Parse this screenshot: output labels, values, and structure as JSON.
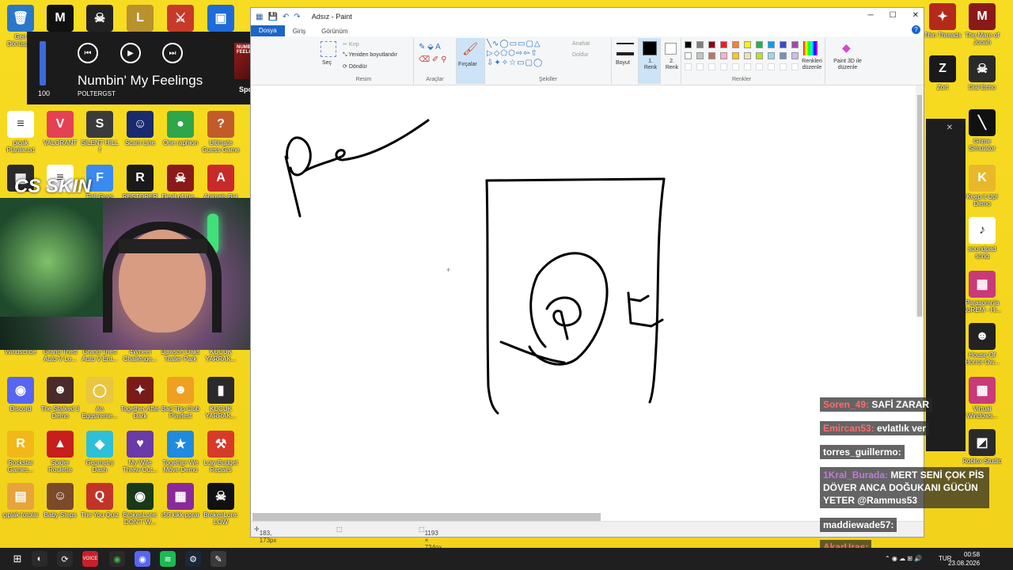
{
  "desktop_left": [
    {
      "label": "Geri Dönüşüm",
      "color": "#2b78c9",
      "glyph": "🗑"
    },
    {
      "label": "",
      "color": "#111",
      "glyph": "M"
    },
    {
      "label": "",
      "color": "#222",
      "glyph": "☠"
    },
    {
      "label": "",
      "color": "#b9922d",
      "glyph": "L"
    },
    {
      "label": "",
      "color": "#c73a2a",
      "glyph": "⚔"
    },
    {
      "label": "",
      "color": "#1e6bd9",
      "glyph": "▣"
    }
  ],
  "desktop_row2": [
    {
      "label": "picak Planlar.txt",
      "color": "#ffffff",
      "glyph": "≡"
    },
    {
      "label": "VALORANT",
      "color": "#e54154",
      "glyph": "V"
    },
    {
      "label": "SILENT HILL f",
      "color": "#3b3b3b",
      "glyph": "S"
    },
    {
      "label": "Scam Line",
      "color": "#1a2a6e",
      "glyph": "☺"
    },
    {
      "label": "One raphion",
      "color": "#2fa64a",
      "glyph": "●"
    },
    {
      "label": "Ultimate Guess Game",
      "color": "#c25b2a",
      "glyph": "?"
    }
  ],
  "desktop_row3": [
    {
      "label": "Discord",
      "color": "#5865f2",
      "glyph": "◉"
    },
    {
      "label": "The Stalked 3 Demo",
      "color": "#4a2a2a",
      "glyph": "☻"
    },
    {
      "label": "An Eggstreme...",
      "color": "#e8c640",
      "glyph": "◯"
    },
    {
      "label": "Together After Dark",
      "color": "#7a1a1a",
      "glyph": "✦"
    },
    {
      "label": "Bad Trip Club Playtest",
      "color": "#f0a020",
      "glyph": "☻"
    },
    {
      "label": "KUÇUK YARRAK...",
      "color": "#2a2a2a",
      "glyph": "▮"
    }
  ],
  "desktop_row4": [
    {
      "label": "Rockstar Games...",
      "color": "#f2b81a",
      "glyph": "R"
    },
    {
      "label": "Spider Roulette",
      "color": "#c81e1e",
      "glyph": "▲"
    },
    {
      "label": "Geometry Dash",
      "color": "#2ec0d8",
      "glyph": "◆"
    },
    {
      "label": "My Wife Threw Out...",
      "color": "#6a3aa8",
      "glyph": "♥"
    },
    {
      "label": "Together We Move Demo",
      "color": "#1f8ae0",
      "glyph": "★"
    },
    {
      "label": "Low-Budget Repairs",
      "color": "#d83a2a",
      "glyph": "⚒"
    }
  ],
  "desktop_row5": [
    {
      "label": "çıplak fotolar",
      "color": "#e6a43a",
      "glyph": "▤"
    },
    {
      "label": "Baby Steps",
      "color": "#7a4a2a",
      "glyph": "☺"
    },
    {
      "label": "The You Quiz",
      "color": "#c2342a",
      "glyph": "Q"
    },
    {
      "label": "BrokenLore: DON'T W...",
      "color": "#183a1a",
      "glyph": "◉"
    },
    {
      "label": "r55 kikk pprar",
      "color": "#8a2a9a",
      "glyph": "▦"
    },
    {
      "label": "BrokenLore: LOW",
      "color": "#111",
      "glyph": "☠"
    }
  ],
  "desktop_mid_labels": [
    "Windscribe",
    "Grand Theft Auto V Le...",
    "Grand Theft Auto V Ent...",
    "4Wheel Challenge...",
    "Dawson Oaks Trailer Park",
    "KUÇUK YARRAK..."
  ],
  "desktop_row_games": [
    {
      "label": "",
      "color": "#2a2a2a",
      "glyph": "▦"
    },
    {
      "label": "",
      "color": "#fff",
      "glyph": "≡"
    },
    {
      "label": "Fall Guys",
      "color": "#3a8af0",
      "glyph": "F"
    },
    {
      "label": "RESTORER",
      "color": "#1a1a1a",
      "glyph": "R"
    },
    {
      "label": "Devil of the...",
      "color": "#8a1a1a",
      "glyph": "☠"
    },
    {
      "label": "Animals Bar",
      "color": "#c82a2a",
      "glyph": "A"
    }
  ],
  "desktop_right": [
    {
      "label": "Thin Threads",
      "color": "#b42a1a",
      "glyph": "✦"
    },
    {
      "label": "The Mare of Jonah",
      "color": "#8a1a1a",
      "glyph": "M"
    },
    {
      "label": "Zort",
      "color": "#1a1a1a",
      "glyph": "Z"
    },
    {
      "label": "Dial Echo",
      "color": "#2a2a2a",
      "glyph": "☠"
    },
    {
      "label": "Grime Simulator",
      "color": "#111",
      "glyph": "╲"
    },
    {
      "label": "Keep it Up! Demo",
      "color": "#e8b82a",
      "glyph": "K"
    },
    {
      "label": "soundpad song",
      "color": "#ffffff",
      "glyph": "♪"
    },
    {
      "label": "Parasomnia NoREM - Hi...",
      "color": "#c83a7a",
      "glyph": "▦"
    },
    {
      "label": "House Of Horror Ow...",
      "color": "#222",
      "glyph": "☻"
    },
    {
      "label": "Virtual Windows...",
      "color": "#c83a7a",
      "glyph": "▦"
    },
    {
      "label": "Roblox Studio",
      "color": "#2a2a2a",
      "glyph": "◩"
    }
  ],
  "spotify": {
    "volume": "100",
    "song": "Numbin' My Feelings",
    "artist": "POLTERGST",
    "brand": "Spotify",
    "cover_text": "NUMBIN' MY FEELINGS",
    "prev_icon": "previous-icon",
    "play_icon": "play-icon",
    "next_icon": "next-icon"
  },
  "watermark": "CS SKIN",
  "paint": {
    "title": "Adsız - Paint",
    "tabs": [
      "Dosya",
      "Giriş",
      "Görünüm"
    ],
    "ribbon": {
      "select": "Seç",
      "crop": "Kırp",
      "resize": "Yeniden boyutlandır",
      "rotate": "Döndür",
      "image_group": "Resim",
      "tools_group": "Araçlar",
      "brushes": "Fırçalar",
      "shapes_group": "Şekiller",
      "outline": "Anahat",
      "fill": "Doldur",
      "size": "Boyut",
      "color1": "1. Renk",
      "color2": "2. Renk",
      "colors_group": "Renkler",
      "edit_colors": "Renkleri düzenle",
      "paint3d": "Paint 3D ile düzenle"
    },
    "palette": [
      "#000000",
      "#7f7f7f",
      "#880015",
      "#ed1c24",
      "#ff7f27",
      "#fff200",
      "#22b14c",
      "#00a2e8",
      "#3f48cc",
      "#a349a4",
      "#ffffff",
      "#c3c3c3",
      "#b97a57",
      "#ffaec9",
      "#ffc90e",
      "#efe4b0",
      "#b5e61d",
      "#99d9ea",
      "#7092be",
      "#c8bfe7"
    ],
    "status_pos": "183, 173px",
    "status_size": "1193 × 734px"
  },
  "chat": [
    {
      "user": "Soren_49:",
      "text": "SAFİ ZARAR"
    },
    {
      "user": "Emircan53:",
      "text": "evlatlık ver"
    },
    {
      "user": "torres_guillermo:",
      "text": ""
    },
    {
      "user": "1Kral_Burada:",
      "text": "MERT SENİ ÇOK PİS DÖVER ANCA DOĞUKANI GÜCÜN YETER @Rammus53"
    },
    {
      "user": "maddiewade57:",
      "text": ""
    },
    {
      "user": "AkarUras:",
      "text": ""
    }
  ],
  "taskbar": {
    "lang": "TUR",
    "time": "00:58",
    "date": "23.08.2026"
  }
}
